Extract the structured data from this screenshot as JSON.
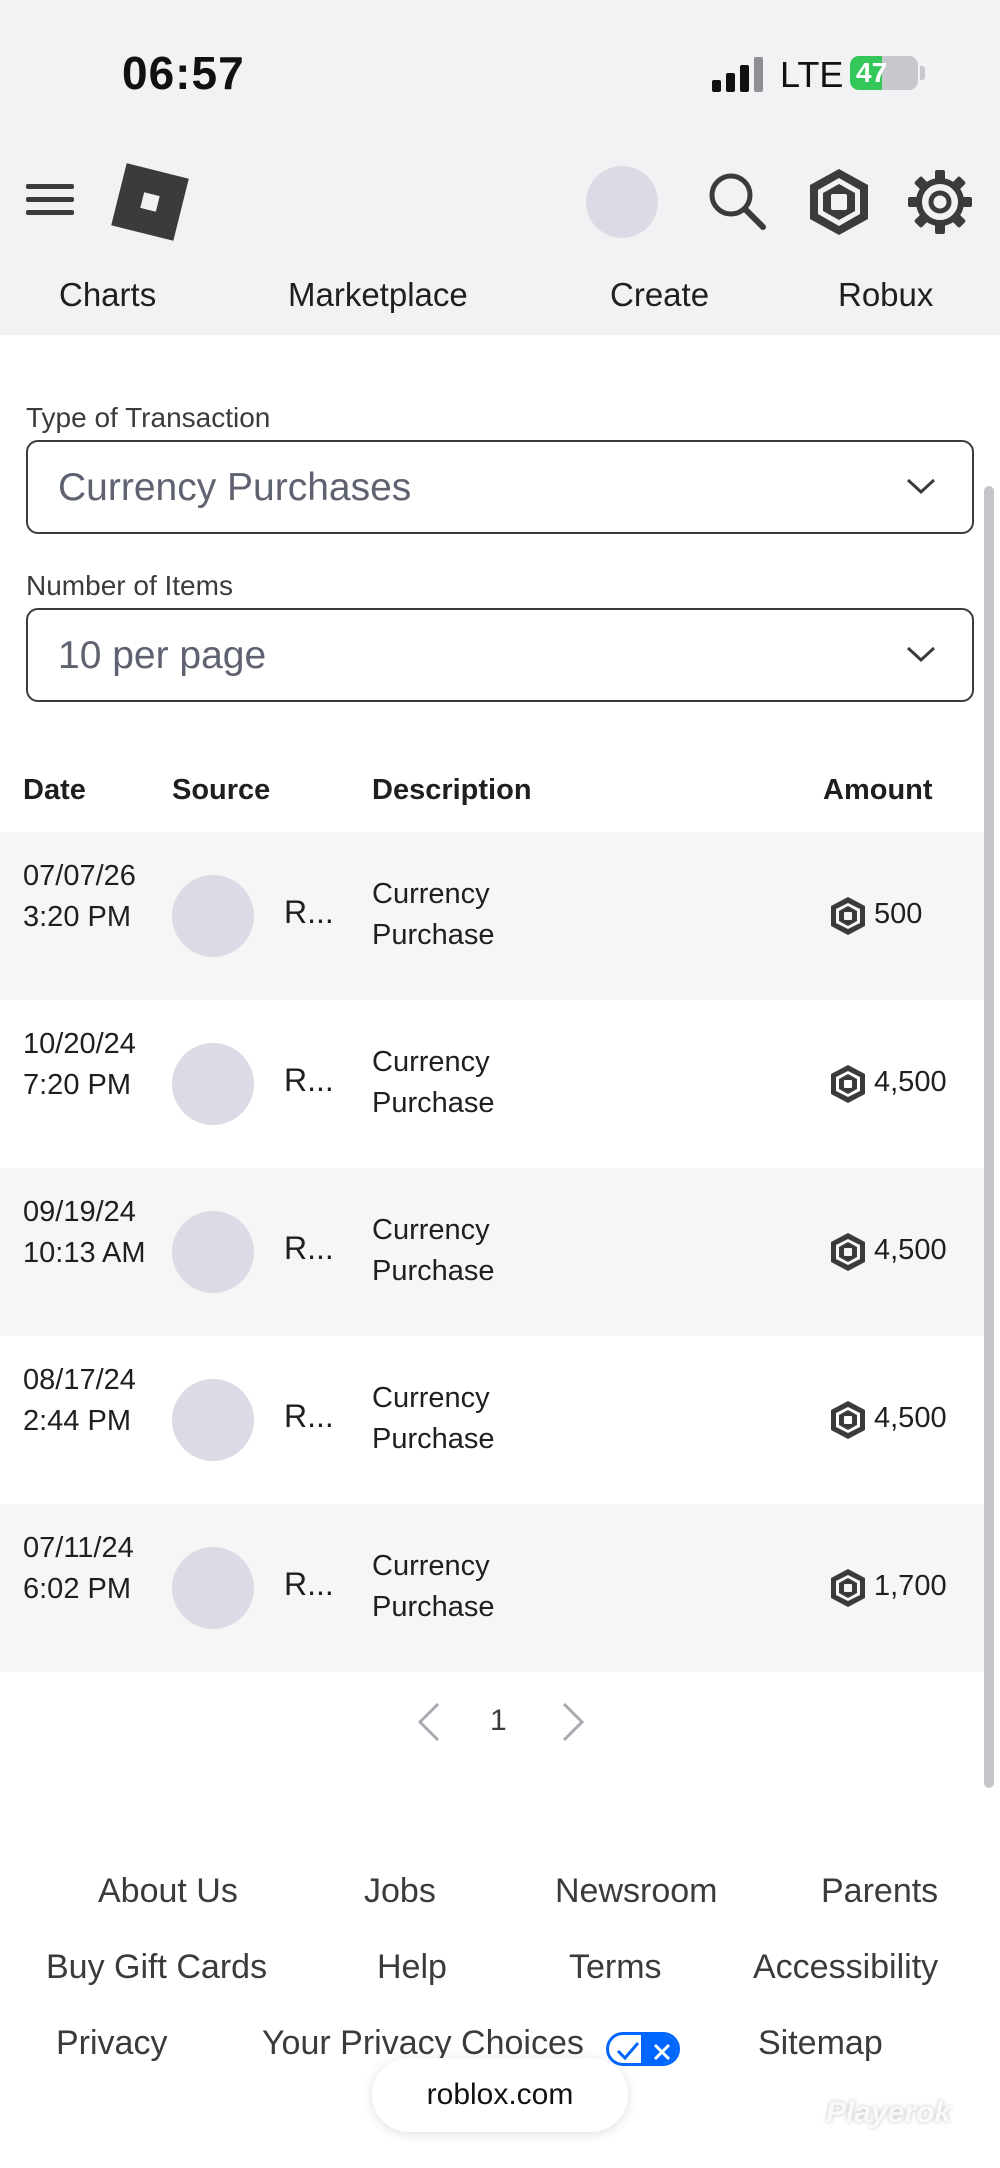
{
  "status_bar": {
    "time": "06:57",
    "network": "LTE",
    "battery_percent": 47,
    "battery_label": "47"
  },
  "header": {
    "nav_tabs": [
      {
        "label": "Charts"
      },
      {
        "label": "Marketplace"
      },
      {
        "label": "Create"
      },
      {
        "label": "Robux"
      }
    ]
  },
  "filters": {
    "transaction_type": {
      "label": "Type of Transaction",
      "value": "Currency Purchases"
    },
    "items_per_page": {
      "label": "Number of Items",
      "value": "10 per page"
    }
  },
  "table": {
    "columns": {
      "date": "Date",
      "source": "Source",
      "description": "Description",
      "amount": "Amount"
    },
    "rows": [
      {
        "date": "07/07/26 3:20 PM",
        "source": "R...",
        "description": "Currency Purchase",
        "amount": "500"
      },
      {
        "date": "10/20/24 7:20 PM",
        "source": "R...",
        "description": "Currency Purchase",
        "amount": "4,500"
      },
      {
        "date": "09/19/24 10:13 AM",
        "source": "R...",
        "description": "Currency Purchase",
        "amount": "4,500"
      },
      {
        "date": "08/17/24 2:44 PM",
        "source": "R...",
        "description": "Currency Purchase",
        "amount": "4,500"
      },
      {
        "date": "07/11/24 6:02 PM",
        "source": "R...",
        "description": "Currency Purchase",
        "amount": "1,700"
      }
    ]
  },
  "pagination": {
    "current_page": "1"
  },
  "footer": {
    "links": {
      "about": "About Us",
      "jobs": "Jobs",
      "newsroom": "Newsroom",
      "parents": "Parents",
      "gift_cards": "Buy Gift Cards",
      "help": "Help",
      "terms": "Terms",
      "accessibility": "Accessibility",
      "privacy": "Privacy",
      "privacy_choices": "Your Privacy Choices",
      "sitemap": "Sitemap"
    }
  },
  "browser": {
    "url": "roblox.com"
  },
  "watermark": "Playerok",
  "colors": {
    "header_bg": "#f2f2f5",
    "text": "#1f1f21",
    "row_shade": "#f6f6f7",
    "privacy_blue": "#0066ff",
    "battery_green": "#34c759"
  }
}
